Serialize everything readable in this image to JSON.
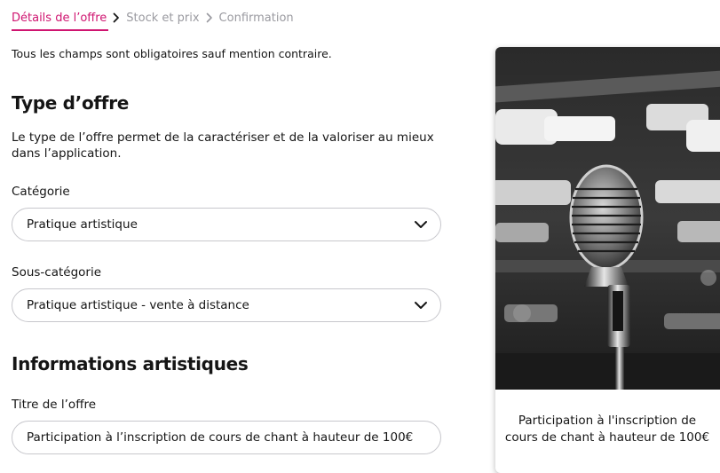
{
  "breadcrumb": {
    "steps": [
      {
        "label": "Détails de l’offre",
        "active": true
      },
      {
        "label": "Stock et prix",
        "active": false
      },
      {
        "label": "Confirmation",
        "active": false
      }
    ]
  },
  "form": {
    "mandatory_notice": "Tous les champs sont obligatoires sauf mention contraire.",
    "offer_type": {
      "heading": "Type d’offre",
      "description": "Le type de l’offre permet de la caractériser et de la valoriser au mieux dans l’application.",
      "category": {
        "label": "Catégorie",
        "value": "Pratique artistique"
      },
      "subcategory": {
        "label": "Sous-catégorie",
        "value": "Pratique artistique - vente à distance"
      }
    },
    "artistic_info": {
      "heading": "Informations artistiques",
      "title_field": {
        "label": "Titre de l’offre",
        "value": "Participation à l’inscription de cours de chant à hauteur de 100€"
      }
    }
  },
  "preview": {
    "title": "Participation à l'inscription de cours de chant à hauteur de 100€"
  },
  "colors": {
    "accent": "#cf1470",
    "muted": "#9a9aa0",
    "border": "#c7c7cc",
    "text": "#151515"
  }
}
